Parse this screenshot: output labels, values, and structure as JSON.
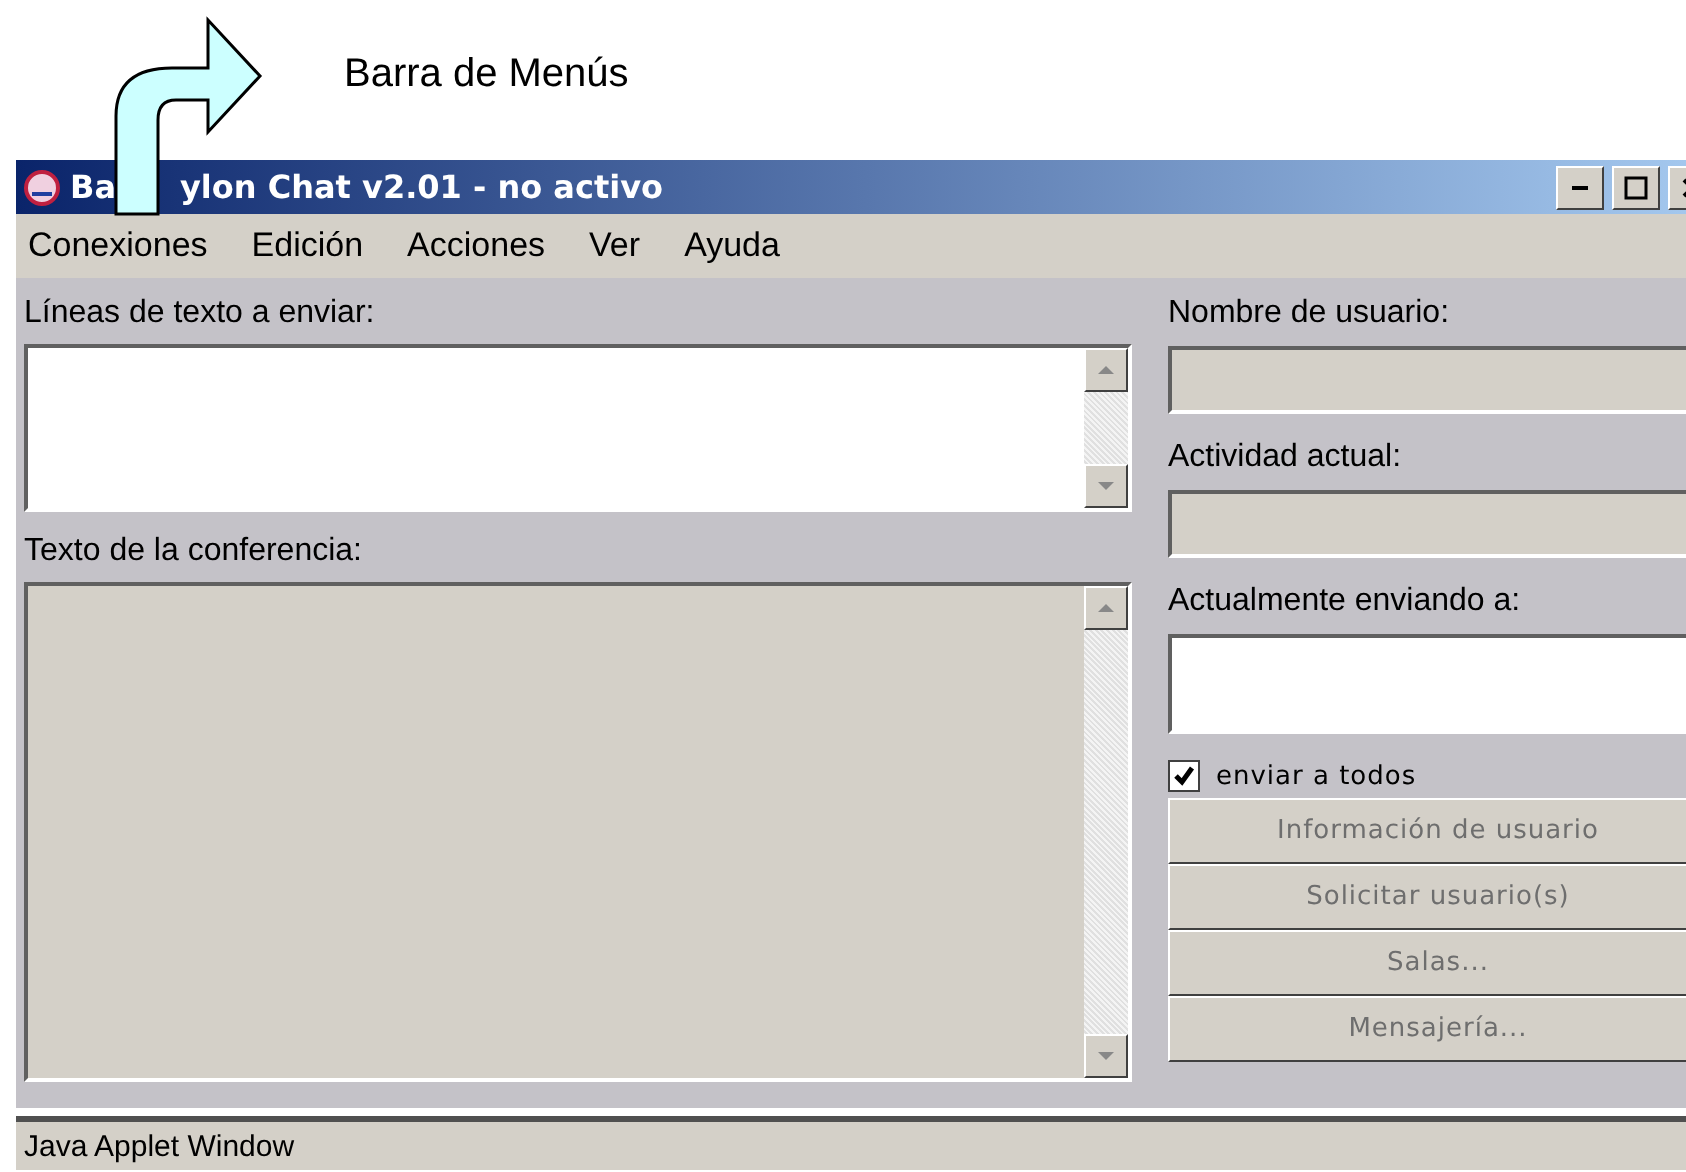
{
  "annotation": {
    "label": "Barra de Menús"
  },
  "window": {
    "title_parts": [
      "Ba",
      "ylon Chat v2.01 - no activo"
    ]
  },
  "menu": [
    "Conexiones",
    "Edición",
    "Acciones",
    "Ver",
    "Ayuda"
  ],
  "left": {
    "send_label": "Líneas de texto a enviar:",
    "conference_label": "Texto de la conferencia:"
  },
  "right": {
    "user_label": "Nombre de usuario:",
    "activity_label": "Actividad actual:",
    "sending_label": "Actualmente enviando a:",
    "send_all": {
      "label": "enviar a todos",
      "checked": true
    },
    "buttons": [
      {
        "label": "Información de usuario",
        "disabled": true
      },
      {
        "label": "Solicitar usuario(s)",
        "disabled": true
      },
      {
        "label": "Salas...",
        "disabled": true
      },
      {
        "label": "Mensajería...",
        "disabled": true
      }
    ]
  },
  "status_bar": "Java Applet Window"
}
